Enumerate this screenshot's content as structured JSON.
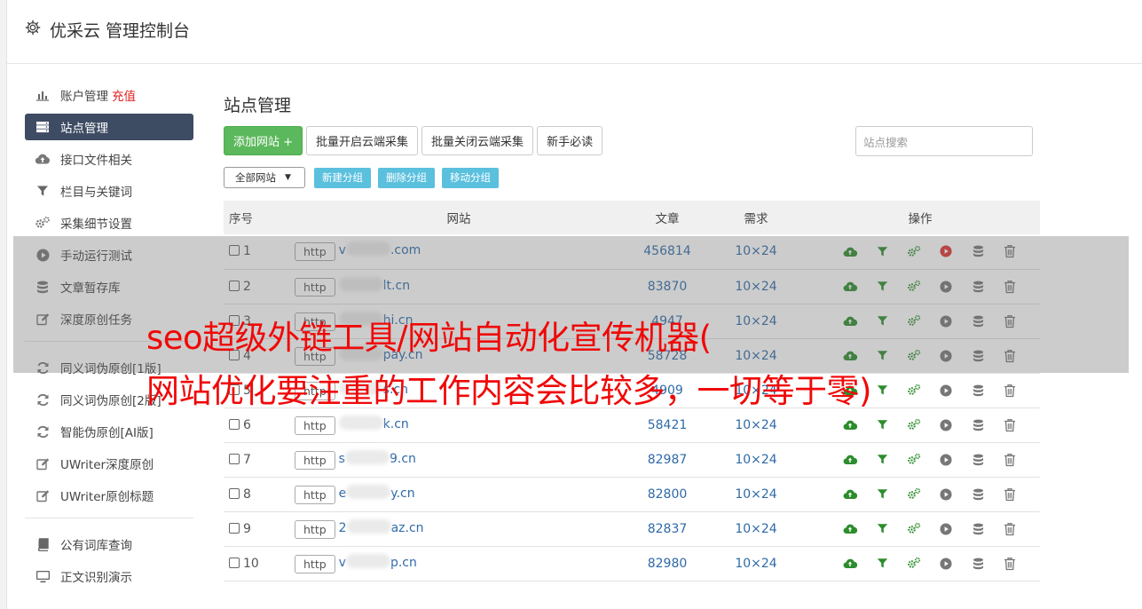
{
  "app": {
    "title": "优采云 管理控制台"
  },
  "sidebar": {
    "items": [
      {
        "label": "账户管理",
        "badge": "充值",
        "icon": "bar-chart-icon",
        "active": false
      },
      {
        "label": "站点管理",
        "icon": "server-list-icon",
        "active": true
      },
      {
        "label": "接口文件相关",
        "icon": "cloud-upload-icon",
        "active": false
      },
      {
        "label": "栏目与关键词",
        "icon": "filter-icon",
        "active": false
      },
      {
        "label": "采集细节设置",
        "icon": "gears-icon",
        "active": false
      },
      {
        "label": "手动运行测试",
        "icon": "play-circle-icon",
        "active": false
      },
      {
        "label": "文章暂存库",
        "icon": "database-icon",
        "active": false
      },
      {
        "label": "深度原创任务",
        "icon": "edit-icon",
        "active": false
      }
    ],
    "items2": [
      {
        "label": "同义词伪原创[1版]",
        "icon": "refresh-icon"
      },
      {
        "label": "同义词伪原创[2版]",
        "icon": "refresh-icon"
      },
      {
        "label": "智能伪原创[AI版]",
        "icon": "refresh-icon"
      },
      {
        "label": "UWriter深度原创",
        "icon": "edit-icon"
      },
      {
        "label": "UWriter原创标题",
        "icon": "edit-icon"
      }
    ],
    "items3": [
      {
        "label": "公有词库查询",
        "icon": "book-icon"
      },
      {
        "label": "正文识别演示",
        "icon": "monitor-icon"
      }
    ]
  },
  "main": {
    "title": "站点管理",
    "buttons": {
      "add": "添加网站 +",
      "batch_on": "批量开启云端采集",
      "batch_off": "批量关闭云端采集",
      "guide": "新手必读"
    },
    "search_placeholder": "站点搜索",
    "group_select": "全部网站",
    "group_buttons": {
      "new": "新建分组",
      "delete": "删除分组",
      "move": "移动分组"
    },
    "table": {
      "headers": {
        "idx": "序号",
        "site": "网站",
        "articles": "文章",
        "need": "需求",
        "ops": "操作"
      },
      "rows": [
        {
          "idx": "1",
          "http": "http",
          "pre": "v",
          "post": ".com",
          "articles": "456814",
          "need": "10×24",
          "play_red": true
        },
        {
          "idx": "2",
          "http": "http",
          "pre": "",
          "post": "lt.cn",
          "articles": "83870",
          "need": "10×24",
          "play_red": false
        },
        {
          "idx": "3",
          "http": "http",
          "pre": "",
          "post": "hi.cn",
          "articles": "4947",
          "need": "10×24",
          "play_red": false
        },
        {
          "idx": "4",
          "http": "http",
          "pre": "",
          "post": "pay.cn",
          "articles": "58728",
          "need": "10×24",
          "play_red": false
        },
        {
          "idx": "5",
          "http": "http",
          "pre": "",
          "post": "s.cn",
          "articles": "4909",
          "need": "10×24",
          "play_red": false
        },
        {
          "idx": "6",
          "http": "http",
          "pre": "",
          "post": "k.cn",
          "articles": "58421",
          "need": "10×24",
          "play_red": false
        },
        {
          "idx": "7",
          "http": "http",
          "pre": "s",
          "post": "9.cn",
          "articles": "82987",
          "need": "10×24",
          "play_red": false
        },
        {
          "idx": "8",
          "http": "http",
          "pre": "e",
          "post": "y.cn",
          "articles": "82800",
          "need": "10×24",
          "play_red": false
        },
        {
          "idx": "9",
          "http": "http",
          "pre": "2",
          "post": "az.cn",
          "articles": "82837",
          "need": "10×24",
          "play_red": false
        },
        {
          "idx": "10",
          "http": "http",
          "pre": "v",
          "post": "p.cn",
          "articles": "82980",
          "need": "10×24",
          "play_red": false
        }
      ]
    }
  },
  "watermark": {
    "line1": "seo超级外链工具/网站自动化宣传机器(",
    "line2": "网站优化要注重的工作内容会比较多，一切等于零)"
  },
  "colors": {
    "sidebar_active": "#3d4b63",
    "green_button": "#5cb85c",
    "info_button": "#5bc0de",
    "link_blue": "#2f6aa8",
    "watermark_red": "#f00808",
    "recharge_red": "#e02020"
  }
}
